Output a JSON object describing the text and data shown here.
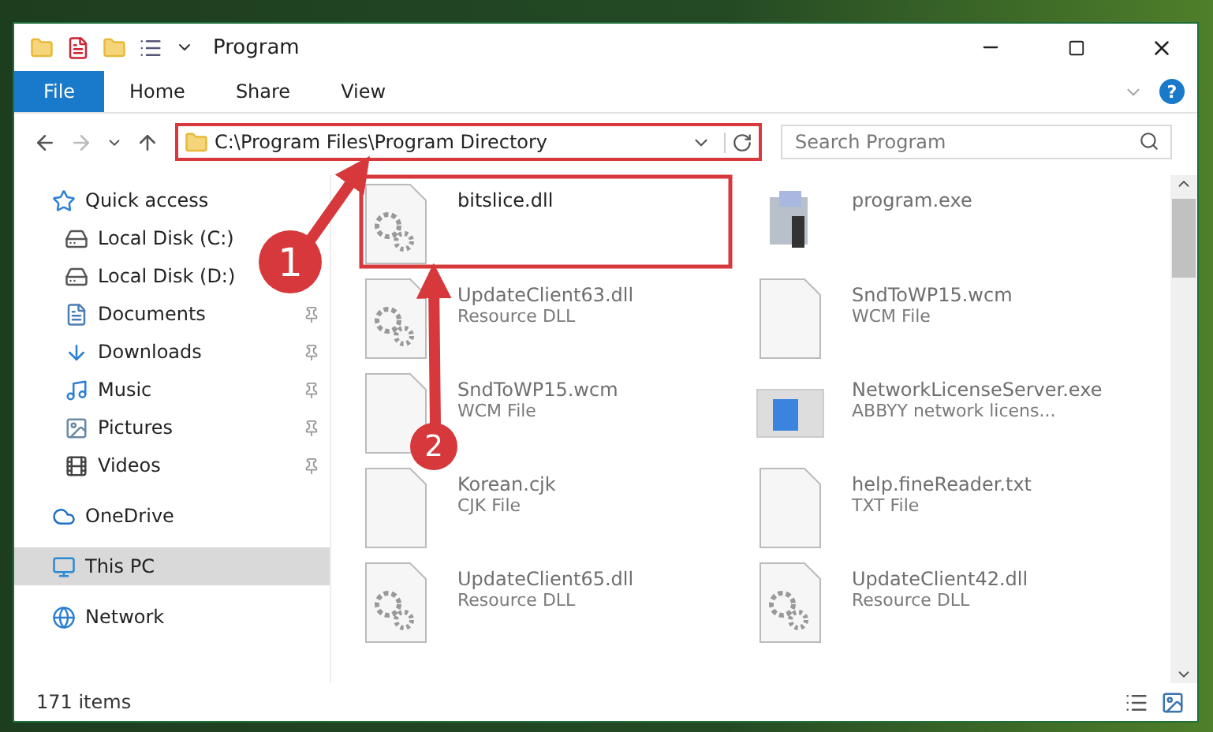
{
  "window": {
    "title": "Program"
  },
  "file_menu": "File",
  "ribbon_tabs": [
    "Home",
    "Share",
    "View"
  ],
  "help": "?",
  "address": {
    "path": "C:\\Program Files\\Program Directory"
  },
  "search": {
    "placeholder": "Search Program"
  },
  "sidebar": [
    {
      "label": "Quick access",
      "selected": false,
      "children": [
        {
          "label": "Local Disk (C:)",
          "pinned": false,
          "selected": false
        },
        {
          "label": "Local Disk (D:)",
          "pinned": false,
          "selected": false
        },
        {
          "label": "Documents",
          "pinned": true,
          "selected": false
        },
        {
          "label": "Downloads",
          "pinned": true,
          "selected": false
        },
        {
          "label": "Music",
          "pinned": true,
          "selected": false
        },
        {
          "label": "Pictures",
          "pinned": true,
          "selected": false
        },
        {
          "label": "Videos",
          "pinned": true,
          "selected": false
        }
      ]
    },
    {
      "label": "OneDrive",
      "selected": false
    },
    {
      "label": "This PC",
      "selected": true
    },
    {
      "label": "Network",
      "selected": false
    }
  ],
  "files": [
    {
      "name": "bitslice.dll",
      "kind": "dll",
      "faded": false
    },
    {
      "name": "program.exe",
      "kind": "exe",
      "faded": true
    },
    {
      "name": "UpdateClient63.dll",
      "type": "Resource DLL",
      "kind": "dll",
      "faded": true
    },
    {
      "name": "SndToWP15.wcm",
      "type": "WCM File",
      "kind": "blank",
      "faded": true
    },
    {
      "name": "SndToWP15.wcm",
      "type": "WCM File",
      "kind": "blank",
      "faded": true
    },
    {
      "name": "NetworkLicenseServer.exe",
      "type": "ABBYY network licens...",
      "kind": "app",
      "faded": true
    },
    {
      "name": "Korean.cjk",
      "type": "CJK File",
      "kind": "blank",
      "faded": true
    },
    {
      "name": "help.fineReader.txt",
      "type": "TXT File",
      "kind": "blank",
      "faded": true
    },
    {
      "name": "UpdateClient65.dll",
      "type": "Resource DLL",
      "kind": "dll",
      "faded": true
    },
    {
      "name": "UpdateClient42.dll",
      "type": "Resource DLL",
      "kind": "dll",
      "faded": true
    }
  ],
  "status_bar": {
    "count": "171 items"
  },
  "steps": [
    "1",
    "2"
  ]
}
